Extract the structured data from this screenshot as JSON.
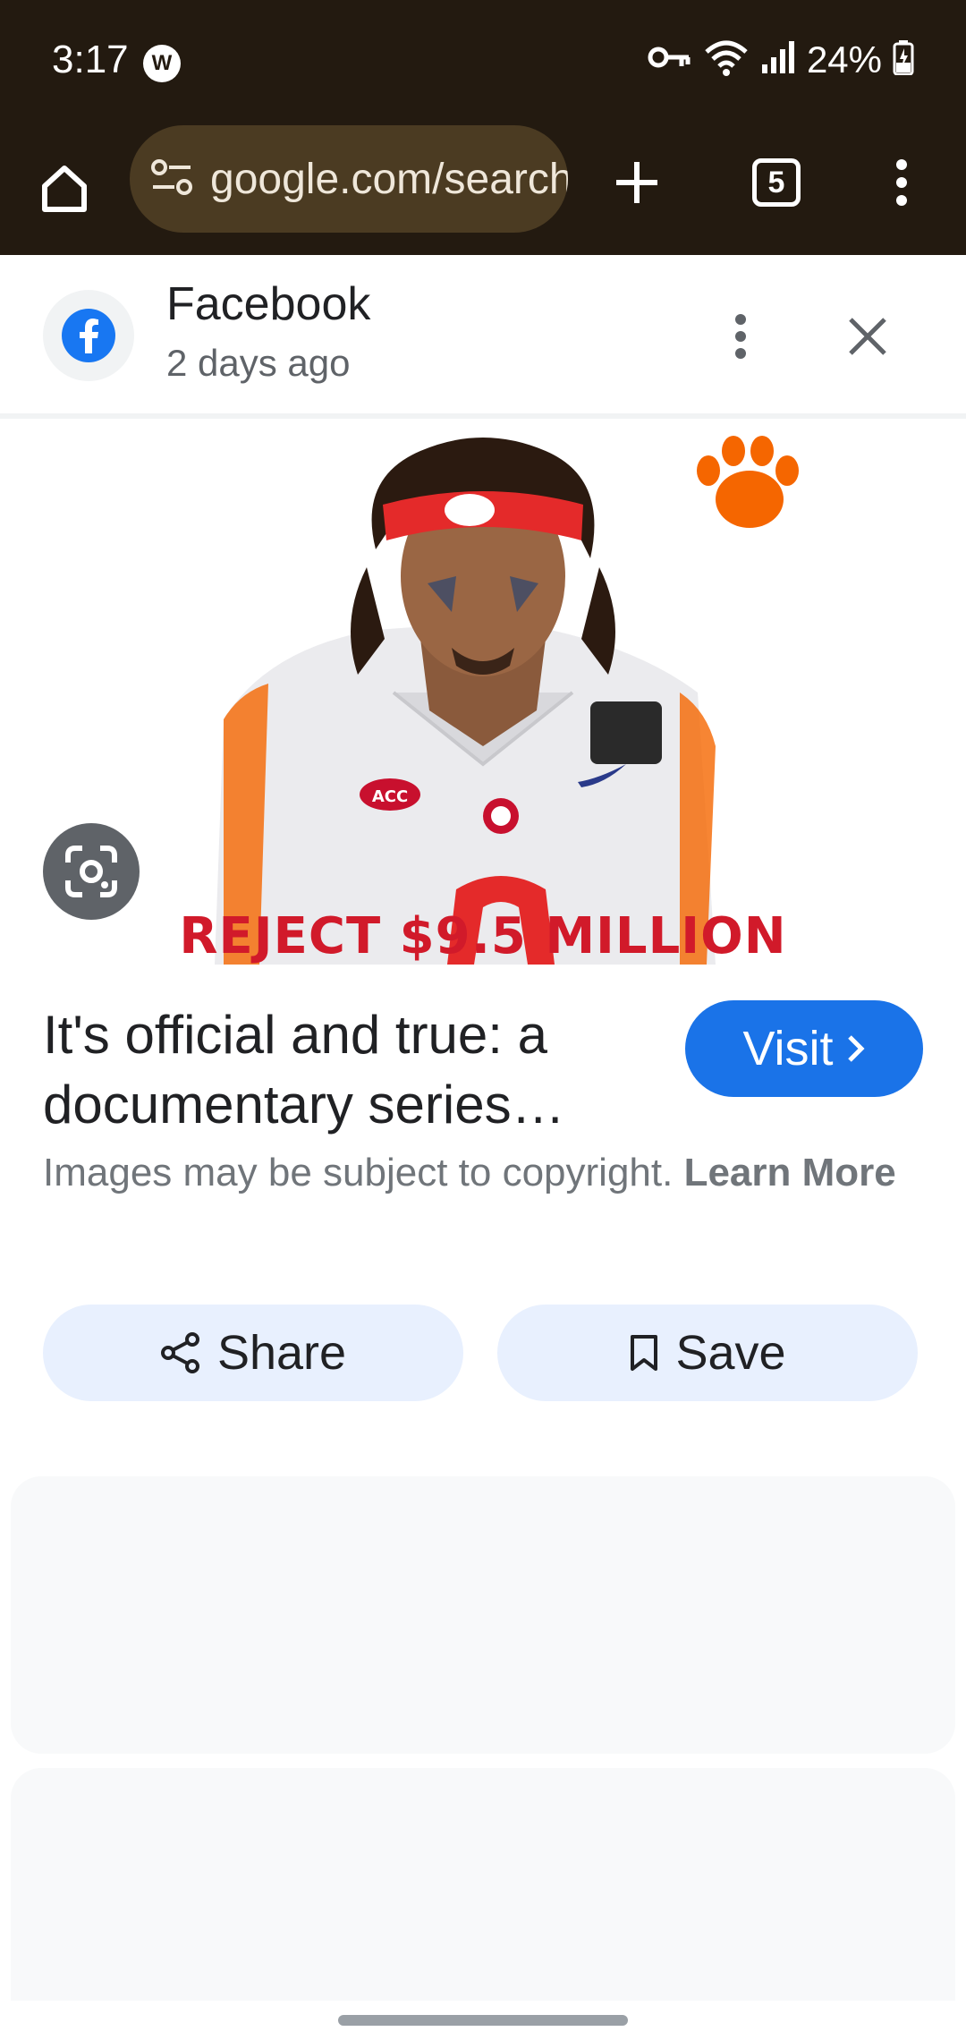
{
  "status_bar": {
    "time": "3:17",
    "battery": "24%",
    "icons": [
      "vpn-key-icon",
      "wifi-icon",
      "signal-icon",
      "battery-charging-icon"
    ]
  },
  "browser": {
    "url": "google.com/search",
    "tab_count": "5"
  },
  "source": {
    "name": "Facebook",
    "time_ago": "2 days ago"
  },
  "image": {
    "caption": "REJECT $9.5 MILLION"
  },
  "result": {
    "title": "It's official and true: a documentary series…",
    "visit_label": "Visit",
    "copyright_text": "Images may be subject to copyright.",
    "copyright_link": "Learn More"
  },
  "actions": {
    "share_label": "Share",
    "save_label": "Save"
  },
  "colors": {
    "browser_chrome": "#231a10",
    "url_pill": "#4b3b22",
    "accent": "#1a73e8",
    "action_bg": "#e8f0fe",
    "caption_red": "#d11a2a",
    "clemson_orange": "#f56600"
  }
}
